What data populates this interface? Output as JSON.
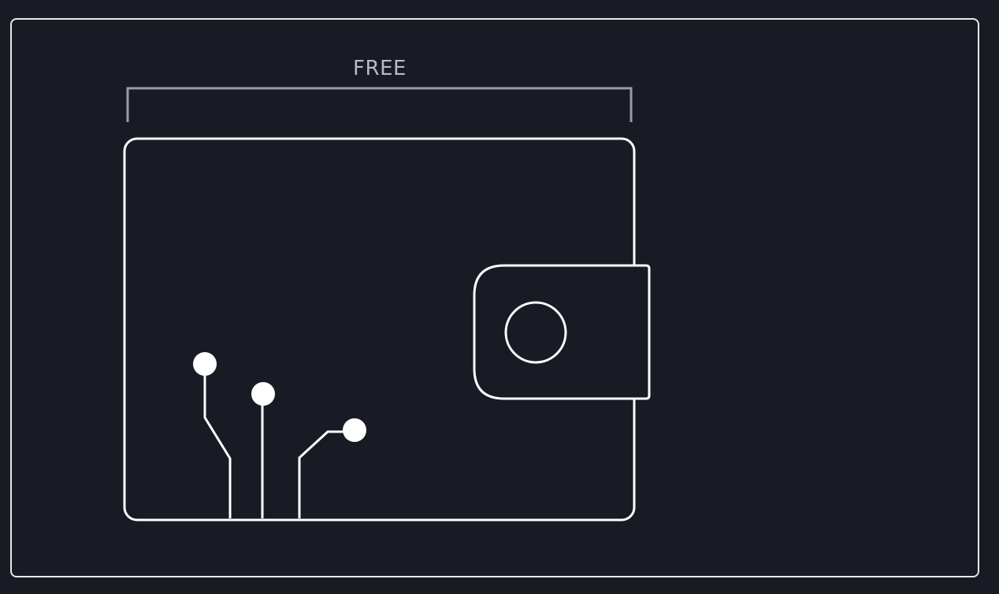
{
  "illustration": {
    "label": "FREE",
    "icon": "wallet-icon",
    "colors": {
      "background": "#191b24",
      "stroke": "#ffffff",
      "bracket": "#9a9ca3",
      "label": "#b9bbc3"
    }
  }
}
